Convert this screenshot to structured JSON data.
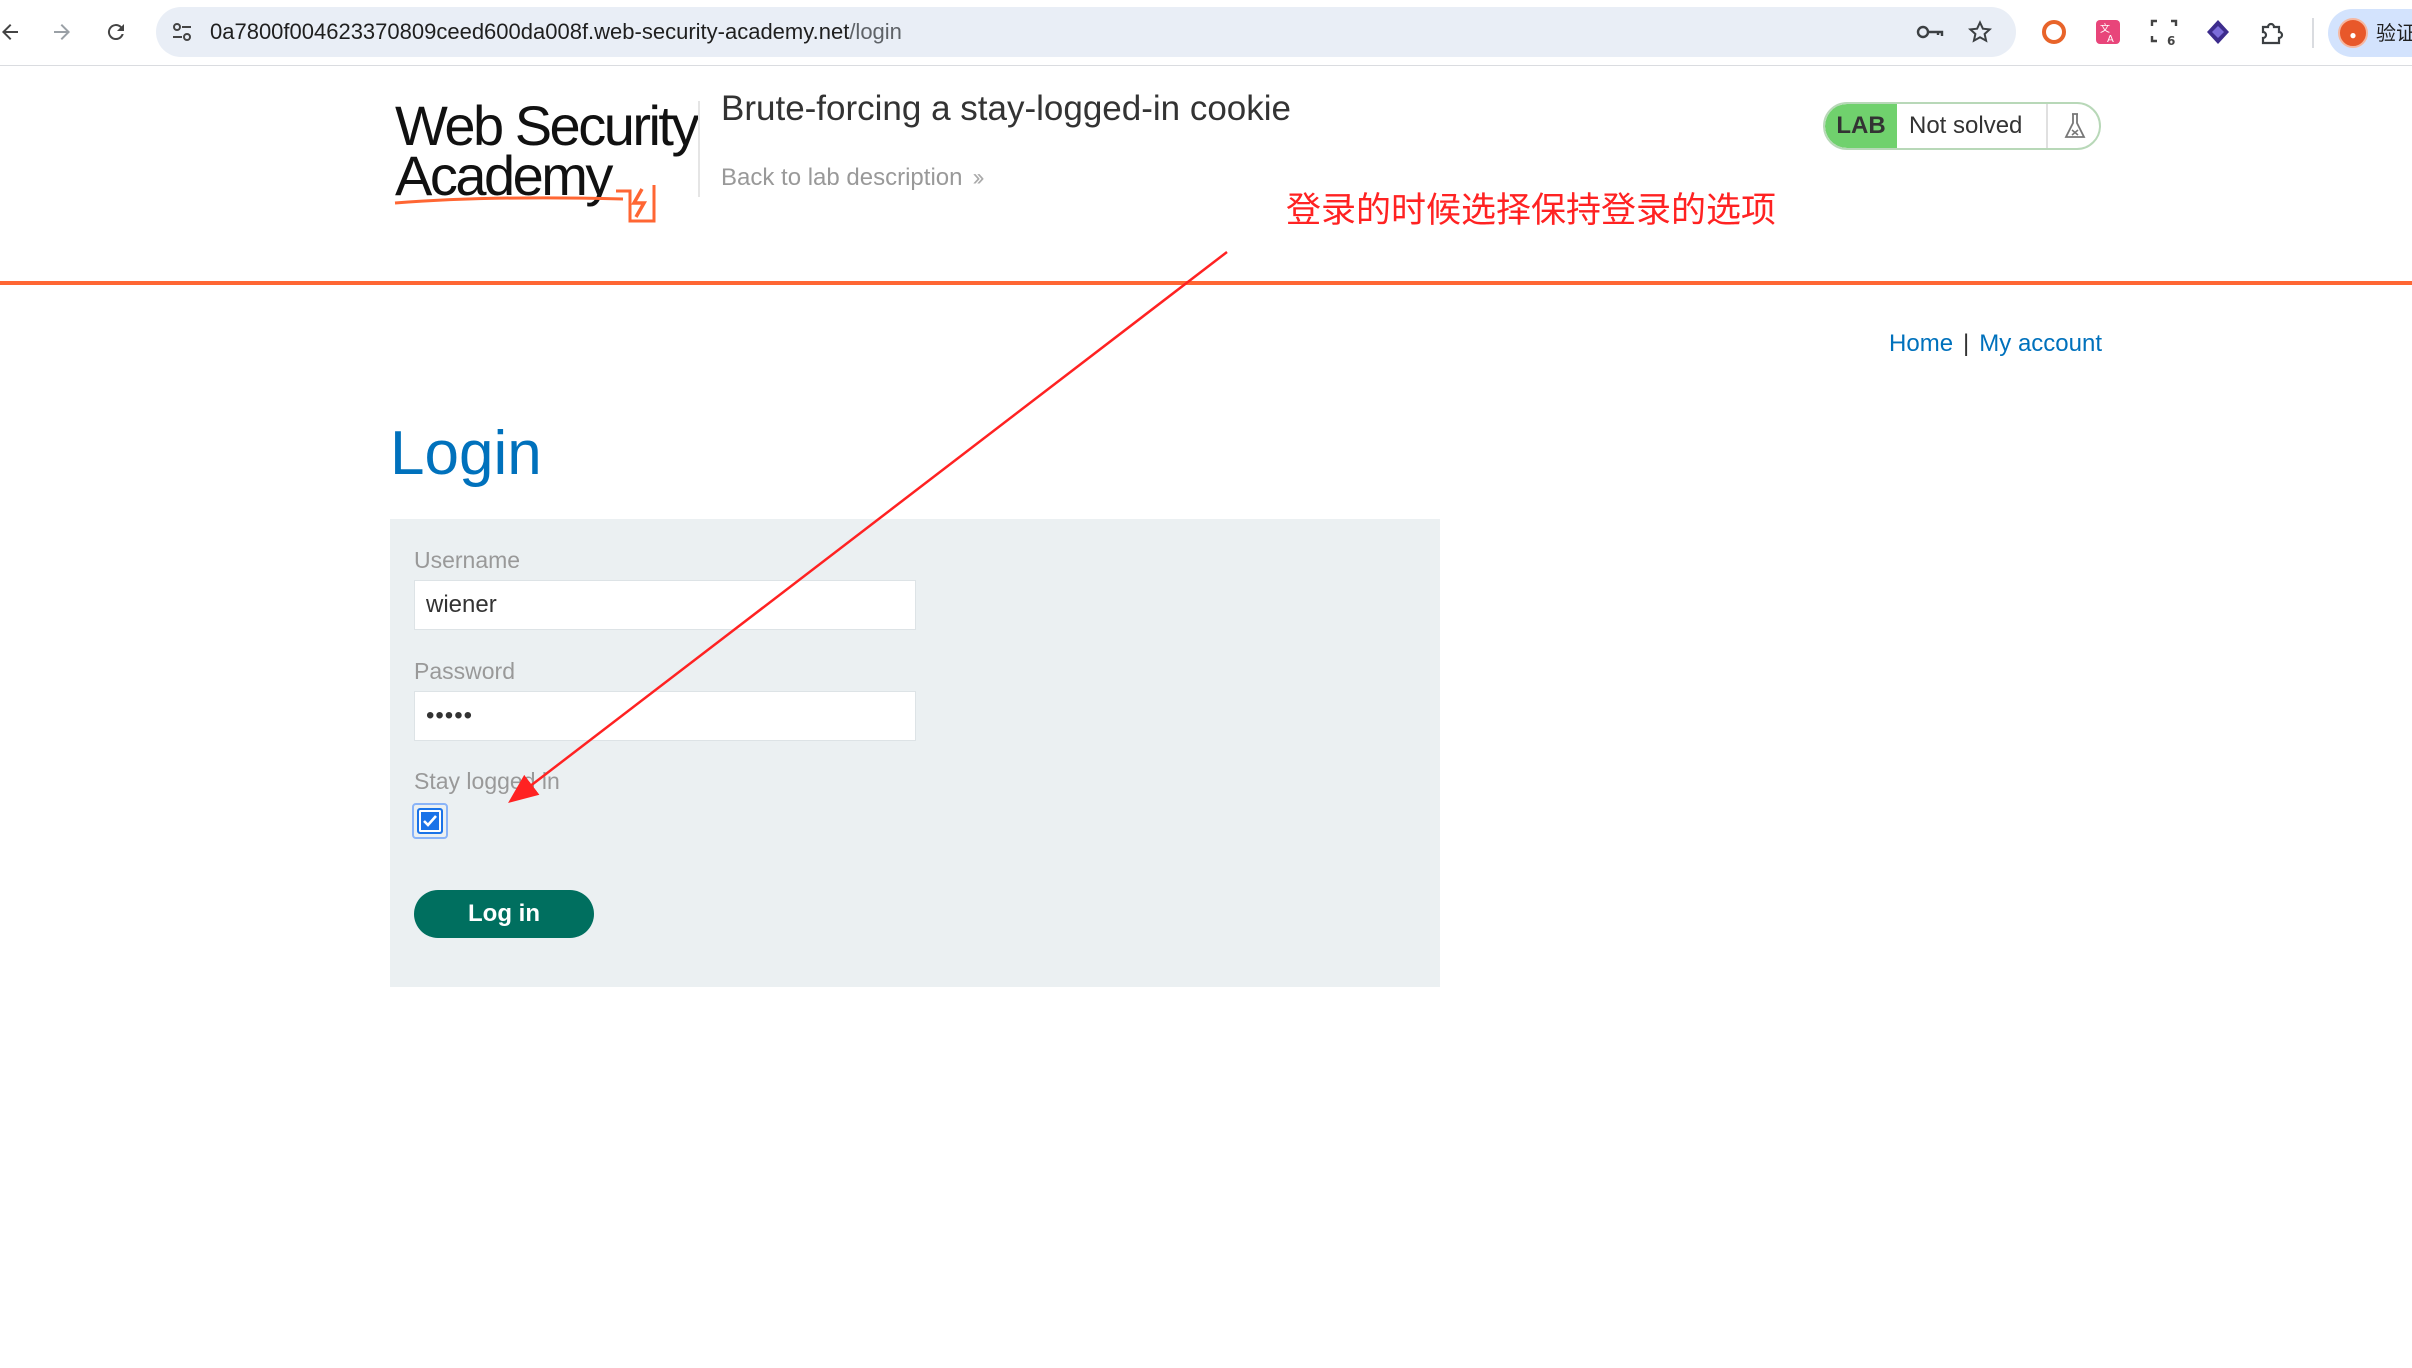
{
  "browser": {
    "url_host": "0a7800f004623370809ceed600da008f.web-security-academy.net",
    "url_path": "/login",
    "profile_text": "验证",
    "icons": [
      "back-icon",
      "forward-icon",
      "reload-icon",
      "site-settings-icon",
      "password-key-icon",
      "bookmark-star-icon",
      "extension-icons",
      "puzzle-icon"
    ],
    "extension_badge": "6"
  },
  "header": {
    "logo_line1": "Web Security",
    "logo_line2": "Academy",
    "lab_title": "Brute-forcing a stay-logged-in cookie",
    "back_link": "Back to lab description",
    "lab_badge": "LAB",
    "lab_status": "Not solved",
    "accent_color": "#ff6633",
    "status_color": "#70d16d"
  },
  "nav": {
    "home": "Home",
    "separator": "|",
    "my_account": "My account"
  },
  "login": {
    "title": "Login",
    "username_label": "Username",
    "username_value": "wiener",
    "password_label": "Password",
    "password_value": "•••••",
    "stay_logged_in_label": "Stay logged in",
    "stay_logged_in_checked": true,
    "submit_label": "Log in",
    "title_color": "#0071bc",
    "button_color": "#006f5f"
  },
  "annotation": {
    "text": "登录的时候选择保持登录的选项",
    "color": "#ff2222"
  }
}
